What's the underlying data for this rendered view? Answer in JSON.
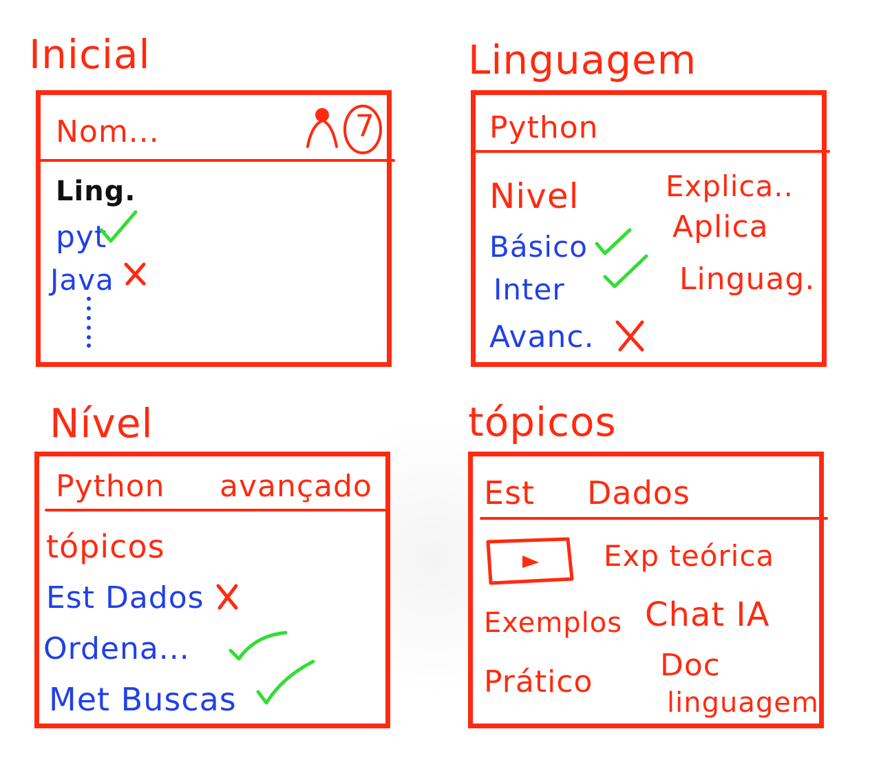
{
  "colors": {
    "frame": "#ff2a10",
    "text_red": "#ff2a10",
    "text_blue": "#2040e8",
    "check": "#33dd33",
    "text_black": "#111111"
  },
  "screens": {
    "inicial": {
      "title": "Inicial",
      "header_name": "Nom...",
      "badge_count": "7",
      "section_label": "Ling.",
      "items": [
        {
          "label": "pyt",
          "status": "check"
        },
        {
          "label": "Java",
          "status": "x"
        }
      ],
      "more": "⋮"
    },
    "linguagem": {
      "title": "Linguagem",
      "header": "Python",
      "level_label": "Nivel",
      "levels": [
        {
          "label": "Básico",
          "status": "check"
        },
        {
          "label": "Inter",
          "status": "check"
        },
        {
          "label": "Avanc.",
          "status": "x"
        }
      ],
      "side_items": [
        "Explica..",
        "Aplica",
        "Linguag."
      ]
    },
    "nivel": {
      "title": "Nível",
      "header": "Python",
      "header_right": "avançado",
      "topics_label": "tópicos",
      "topics": [
        {
          "label": "Est Dados",
          "status": "x"
        },
        {
          "label": "Ordena...",
          "status": "check"
        },
        {
          "label": "Met Buscas",
          "status": "check"
        }
      ]
    },
    "topicos": {
      "title": "tópicos",
      "header": "Est",
      "header_right": "Dados",
      "video_icon": "play-icon",
      "items": [
        "Exp teórica",
        "Exemplos",
        "Chat IA",
        "Prático",
        "Doc",
        "linguagem"
      ]
    }
  }
}
